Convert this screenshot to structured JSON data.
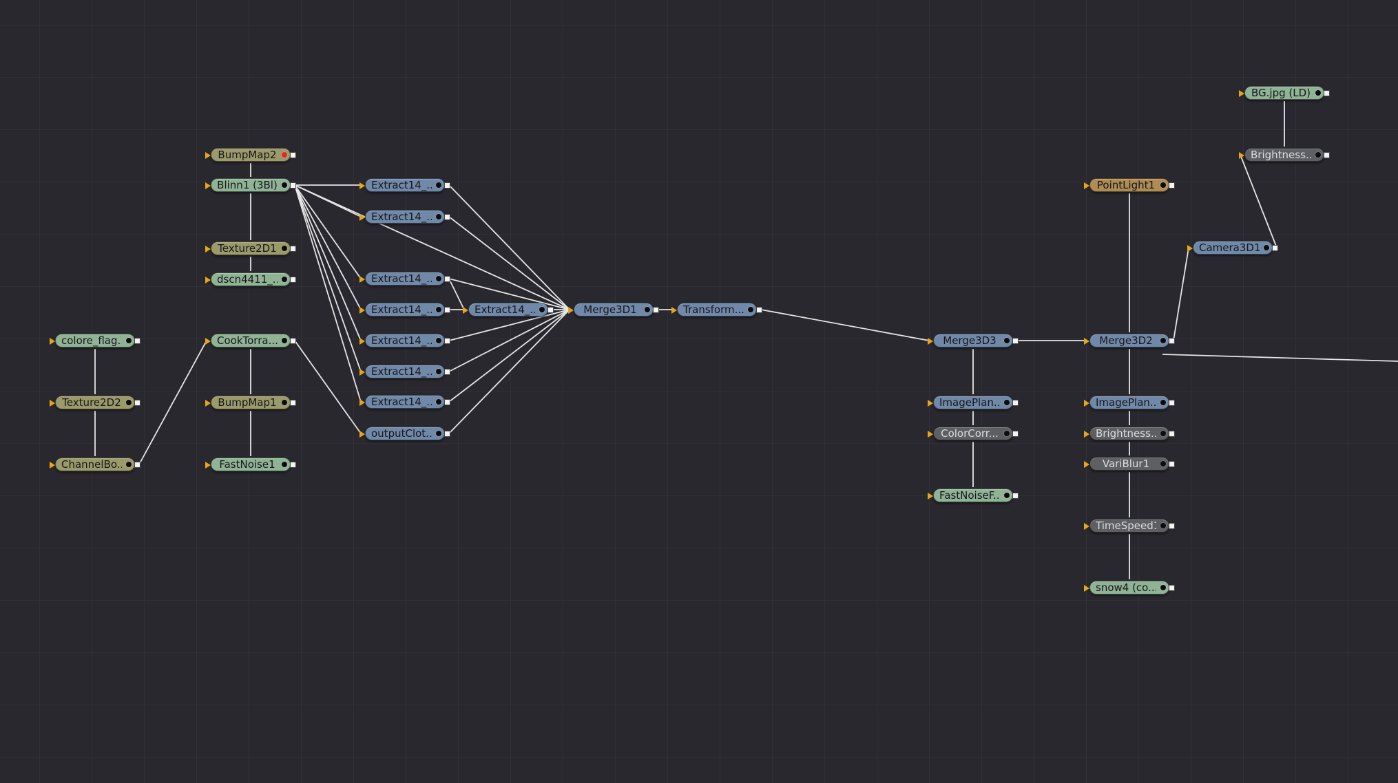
{
  "colors": {
    "background": "#28282e",
    "wire": "#e6e6e6",
    "blue_node": "#7189a8",
    "green_node": "#8fb394",
    "olive_node": "#9b9a6b",
    "gray_node": "#5e5f62",
    "brown_node": "#b08c55",
    "red_dot": "#ee2222",
    "port_orange": "#e8a616",
    "port_blue": "#8c8cee",
    "port_green": "#6fd296"
  },
  "nodes": [
    {
      "id": "bumpmap2",
      "label": "BumpMap2",
      "type": "olive",
      "hasRedDot": true
    },
    {
      "id": "blinn1",
      "label": "Blinn1  (3Bl)",
      "type": "green"
    },
    {
      "id": "texture2d1",
      "label": "Texture2D1",
      "type": "olive"
    },
    {
      "id": "dscn4411",
      "label": "dscn4411_...",
      "type": "green"
    },
    {
      "id": "colore_flag",
      "label": "colore_flag...",
      "type": "green"
    },
    {
      "id": "texture2d2",
      "label": "Texture2D2",
      "type": "olive"
    },
    {
      "id": "channelbo",
      "label": "ChannelBo...",
      "type": "olive"
    },
    {
      "id": "cooktorra",
      "label": "CookTorra...",
      "type": "green"
    },
    {
      "id": "bumpmap1",
      "label": "BumpMap1",
      "type": "olive"
    },
    {
      "id": "fastnoise1",
      "label": "FastNoise1",
      "type": "green"
    },
    {
      "id": "extract_a",
      "label": "Extract14_...",
      "type": "blue"
    },
    {
      "id": "extract_b",
      "label": "Extract14_...",
      "type": "blue"
    },
    {
      "id": "extract_c",
      "label": "Extract14_...",
      "type": "blue"
    },
    {
      "id": "extract_d",
      "label": "Extract14_...",
      "type": "blue"
    },
    {
      "id": "extract_e",
      "label": "Extract14_...",
      "type": "blue"
    },
    {
      "id": "extract_f",
      "label": "Extract14_...",
      "type": "blue"
    },
    {
      "id": "extract_g",
      "label": "Extract14_...",
      "type": "blue"
    },
    {
      "id": "outputclot",
      "label": "outputClot...",
      "type": "blue"
    },
    {
      "id": "extract_h",
      "label": "Extract14_...",
      "type": "blue"
    },
    {
      "id": "merge3d1",
      "label": "Merge3D1",
      "type": "blue"
    },
    {
      "id": "transform",
      "label": "Transform...",
      "type": "blue"
    },
    {
      "id": "merge3d3",
      "label": "Merge3D3",
      "type": "blue"
    },
    {
      "id": "imageplan1",
      "label": "ImagePlan...",
      "type": "blue"
    },
    {
      "id": "colorcorr",
      "label": "ColorCorr...",
      "type": "gray"
    },
    {
      "id": "fastnoisef",
      "label": "FastNoiseF...",
      "type": "green"
    },
    {
      "id": "merge3d2",
      "label": "Merge3D2",
      "type": "blue"
    },
    {
      "id": "imageplan2",
      "label": "ImagePlan...",
      "type": "blue"
    },
    {
      "id": "brightness2",
      "label": "Brightness...",
      "type": "gray"
    },
    {
      "id": "variblur1",
      "label": "VariBlur1",
      "type": "gray"
    },
    {
      "id": "timespeed1",
      "label": "TimeSpeed1",
      "type": "gray"
    },
    {
      "id": "snow4",
      "label": "snow4 (co...",
      "type": "green"
    },
    {
      "id": "pointlight1",
      "label": "PointLight1",
      "type": "brown"
    },
    {
      "id": "bgjpg",
      "label": "BG.jpg  (LD)",
      "type": "green"
    },
    {
      "id": "brightness1",
      "label": "Brightness...",
      "type": "gray"
    },
    {
      "id": "camera3d1",
      "label": "Camera3D1",
      "type": "blue"
    }
  ],
  "connections": [
    [
      "bumpmap2",
      "blinn1"
    ],
    [
      "texture2d1",
      "blinn1"
    ],
    [
      "dscn4411",
      "texture2d1"
    ],
    [
      "colore_flag",
      "texture2d2"
    ],
    [
      "texture2d2",
      "channelbo"
    ],
    [
      "channelbo",
      "cooktorra"
    ],
    [
      "bumpmap1",
      "cooktorra"
    ],
    [
      "fastnoise1",
      "bumpmap1"
    ],
    [
      "cooktorra",
      "outputclot"
    ],
    [
      "blinn1",
      "extract_a"
    ],
    [
      "blinn1",
      "extract_b"
    ],
    [
      "blinn1",
      "extract_c"
    ],
    [
      "blinn1",
      "extract_d"
    ],
    [
      "blinn1",
      "extract_e"
    ],
    [
      "blinn1",
      "extract_f"
    ],
    [
      "blinn1",
      "extract_g"
    ],
    [
      "blinn1",
      "merge3d1"
    ],
    [
      "extract_a",
      "merge3d1"
    ],
    [
      "extract_b",
      "merge3d1"
    ],
    [
      "extract_c",
      "merge3d1"
    ],
    [
      "extract_c",
      "extract_h"
    ],
    [
      "extract_d",
      "extract_h"
    ],
    [
      "extract_h",
      "merge3d1"
    ],
    [
      "extract_e",
      "merge3d1"
    ],
    [
      "extract_f",
      "merge3d1"
    ],
    [
      "extract_g",
      "merge3d1"
    ],
    [
      "outputclot",
      "merge3d1"
    ],
    [
      "merge3d1",
      "transform"
    ],
    [
      "transform",
      "merge3d3"
    ],
    [
      "imageplan1",
      "merge3d3"
    ],
    [
      "colorcorr",
      "imageplan1"
    ],
    [
      "fastnoisef",
      "colorcorr"
    ],
    [
      "merge3d3",
      "merge3d2"
    ],
    [
      "pointlight1",
      "merge3d2"
    ],
    [
      "camera3d1",
      "merge3d2"
    ],
    [
      "brightness1",
      "camera3d1"
    ],
    [
      "bgjpg",
      "brightness1"
    ],
    [
      "imageplan2",
      "merge3d2"
    ],
    [
      "brightness2",
      "imageplan2"
    ],
    [
      "variblur1",
      "brightness2"
    ],
    [
      "timespeed1",
      "variblur1"
    ],
    [
      "snow4",
      "timespeed1"
    ],
    [
      "merge3d2",
      "offscreen"
    ]
  ]
}
